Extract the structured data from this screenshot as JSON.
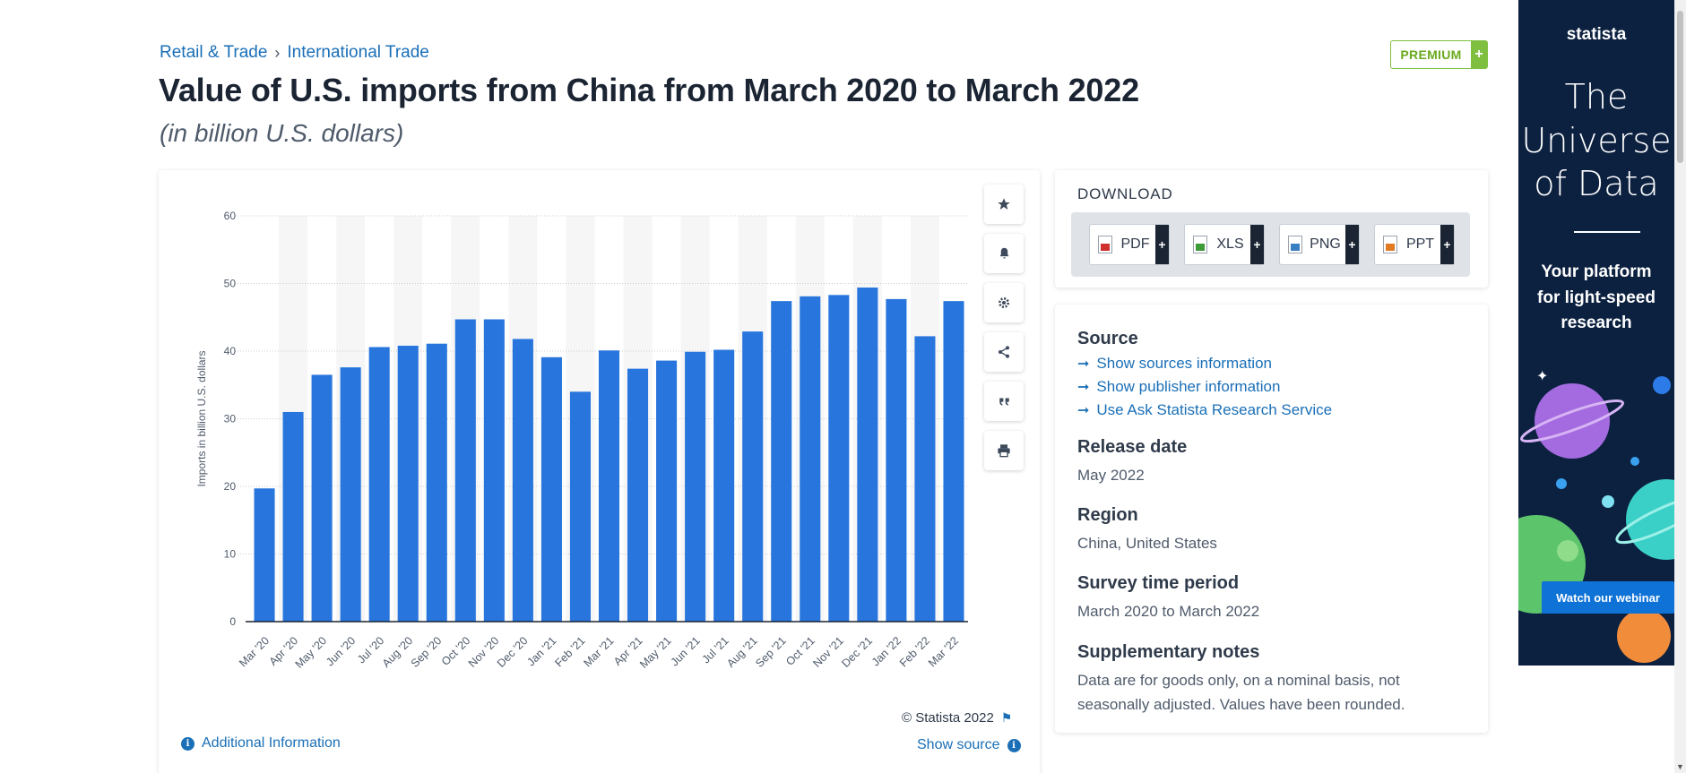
{
  "breadcrumb": {
    "item1": "Retail & Trade",
    "separator": "›",
    "item2": "International Trade"
  },
  "header": {
    "title": "Value of U.S. imports from China from March 2020 to March 2022",
    "subtitle": "(in billion U.S. dollars)",
    "premium_label": "PREMIUM",
    "premium_plus": "+"
  },
  "chart_data": {
    "type": "bar",
    "categories": [
      "Mar '20",
      "Apr '20",
      "May '20",
      "Jun '20",
      "Jul '20",
      "Aug '20",
      "Sep '20",
      "Oct '20",
      "Nov '20",
      "Dec '20",
      "Jan '21",
      "Feb '21",
      "Mar '21",
      "Apr '21",
      "May '21",
      "Jun '21",
      "Jul '21",
      "Aug '21",
      "Sep '21",
      "Oct '21",
      "Nov '21",
      "Dec '21",
      "Jan '22",
      "Feb '22",
      "Mar '22"
    ],
    "values": [
      19.7,
      31,
      36.5,
      37.6,
      40.6,
      40.8,
      41.1,
      44.7,
      44.7,
      41.8,
      39.1,
      34,
      40.1,
      37.4,
      38.6,
      39.9,
      40.2,
      42.9,
      47.4,
      48.1,
      48.3,
      49.4,
      47.7,
      42.2,
      47.4
    ],
    "ylabel": "Imports in billion U.S. dollars",
    "xlabel": "",
    "ylim": [
      0,
      60
    ],
    "yticks": [
      "0",
      "10",
      "20",
      "30",
      "40",
      "50",
      "60"
    ],
    "grid": true,
    "bar_color": "#2876dd"
  },
  "chart_footer": {
    "copyright": "© Statista 2022",
    "additional_info": "Additional Information",
    "show_source": "Show source"
  },
  "tools": [
    "star-icon",
    "bell-icon",
    "gear-icon",
    "share-icon",
    "quote-icon",
    "print-icon"
  ],
  "download": {
    "title": "DOWNLOAD",
    "buttons": [
      {
        "label": "PDF",
        "color": "#d0312d"
      },
      {
        "label": "XLS",
        "color": "#3e9b3a"
      },
      {
        "label": "PNG",
        "color": "#3a7fc4"
      },
      {
        "label": "PPT",
        "color": "#e07b22"
      }
    ],
    "plus": "+"
  },
  "source": {
    "title": "Source",
    "links": [
      "Show sources information",
      "Show publisher information",
      "Use Ask Statista Research Service"
    ],
    "release_date_label": "Release date",
    "release_date": "May 2022",
    "region_label": "Region",
    "region": "China, United States",
    "survey_label": "Survey time period",
    "survey": "March 2020 to March 2022",
    "notes_label": "Supplementary notes",
    "notes": "Data are for goods only, on a nominal basis, not seasonally adjusted. Values have been rounded."
  },
  "ad": {
    "logo": "statista",
    "headline_l1": "The",
    "headline_l2": "Universe",
    "headline_l3": "of Data",
    "sub_l1": "Your platform",
    "sub_l2": "for light-speed",
    "sub_l3": "research",
    "button": "Watch our webinar"
  }
}
